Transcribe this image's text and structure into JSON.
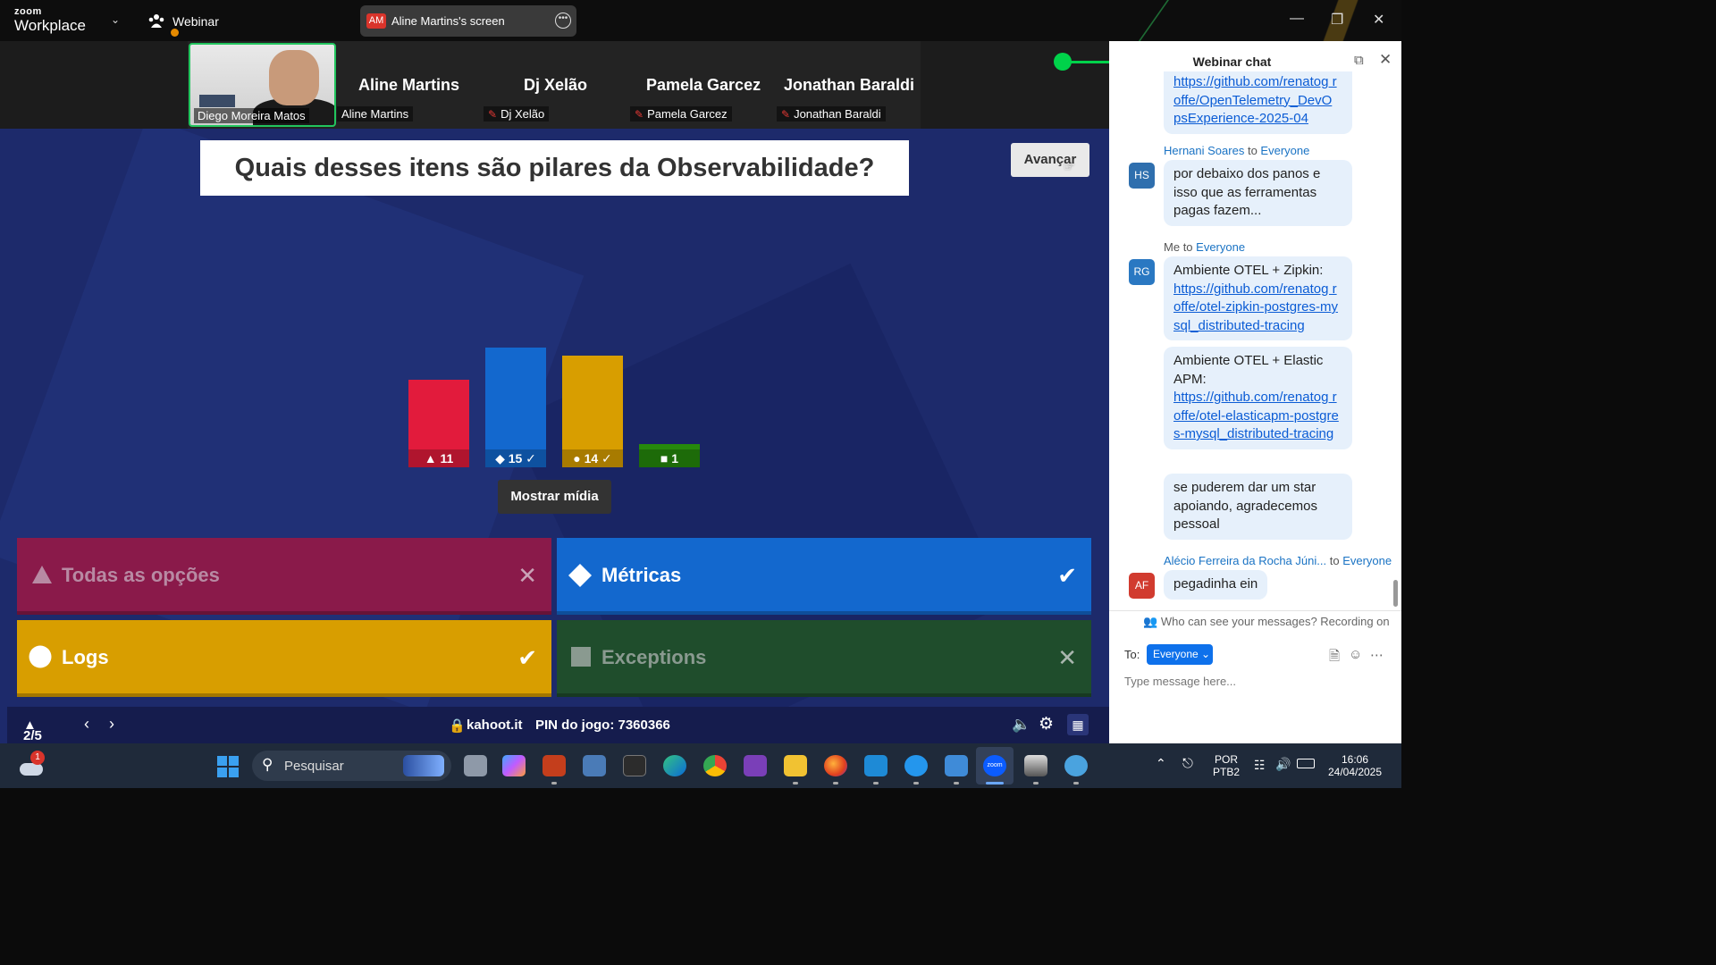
{
  "app": {
    "logo_top": "zoom",
    "logo_bottom": "Workplace",
    "webinar_label": "Webinar",
    "screen_share_initials": "AM",
    "screen_share_label": "Aline Martins's screen"
  },
  "participants": {
    "camera_name": "Diego Moreira Matos",
    "tiles": [
      {
        "big_name": "Aline Martins",
        "tag": "Aline Martins",
        "muted": false
      },
      {
        "big_name": "Dj Xelão",
        "tag": "Dj Xelão",
        "muted": true
      },
      {
        "big_name": "Pamela Garcez",
        "tag": "Pamela Garcez",
        "muted": true
      },
      {
        "big_name": "Jonathan Baraldi",
        "tag": "Jonathan Baraldi",
        "muted": true
      }
    ]
  },
  "kahoot": {
    "question": "Quais desses itens são pilares da Observabilidade?",
    "advance_button": "Avançar",
    "show_media_button": "Mostrar mídia",
    "answers": [
      {
        "label": "Todas as opções",
        "shape": "triangle",
        "correct": false,
        "color": "#8a1a4a"
      },
      {
        "label": "Métricas",
        "shape": "diamond",
        "correct": true,
        "color": "#1368ce"
      },
      {
        "label": "Logs",
        "shape": "circle",
        "correct": true,
        "color": "#d89e00"
      },
      {
        "label": "Exceptions",
        "shape": "square",
        "correct": false,
        "color": "#1f4d2c"
      }
    ],
    "progress": "2/5",
    "site": "kahoot.it",
    "pin_label": "PIN do jogo: 7360366"
  },
  "chart_data": {
    "type": "bar",
    "categories": [
      "triangle",
      "diamond",
      "circle",
      "square"
    ],
    "values": [
      11,
      15,
      14,
      1
    ],
    "value_labels": [
      "11",
      "15",
      "14",
      "1"
    ],
    "correct": [
      false,
      true,
      true,
      false
    ],
    "colors": [
      "#e21b3c",
      "#1368ce",
      "#d89e00",
      "#26890c"
    ],
    "ylim": [
      0,
      15
    ]
  },
  "chat": {
    "title": "Webinar chat",
    "messages": [
      {
        "sender": "",
        "to": "",
        "avatar": "",
        "text": "",
        "link": "https://github.com/renatogroffe/OpenTelemetry_DevOpsExperience-2025-04",
        "link_visible": "https://github.com/renatog roffe/OpenTelemetry_DevO psExperience-2025-04"
      },
      {
        "sender": "Hernani Soares",
        "to": "Everyone",
        "avatar": "HS",
        "text": "por debaixo dos panos e isso que as ferramentas pagas fazem..."
      },
      {
        "sender": "Me",
        "to": "Everyone",
        "avatar": "RG",
        "text": "Ambiente OTEL + Zipkin:",
        "link_visible": "https://github.com/renatog roffe/otel-zipkin-postgres-mysql_distributed-tracing"
      },
      {
        "text": "Ambiente OTEL + Elastic APM:",
        "link_visible": "https://github.com/renatog roffe/otel-elasticapm-postgres-mysql_distributed-tracing"
      },
      {
        "text": "se puderem dar um star apoiando, agradecemos pessoal"
      },
      {
        "sender": "Alécio Ferreira da Rocha Júni...",
        "to": "Everyone",
        "avatar": "AF",
        "text": "pegadinha ein"
      }
    ],
    "to_word": "to",
    "privacy_note": "Who can see your messages? Recording on",
    "to_label": "To:",
    "recipient": "Everyone",
    "input_placeholder": "Type message here..."
  },
  "taskbar": {
    "search_placeholder": "Pesquisar",
    "weather_badge": "1",
    "language_top": "POR",
    "language_bottom": "PTB2",
    "time": "16:06",
    "date": "24/04/2025"
  },
  "colors": {
    "kahoot_bg": "#1d2a6b",
    "zoom_accent": "#0e71eb",
    "active_speaker": "#22c55e"
  }
}
